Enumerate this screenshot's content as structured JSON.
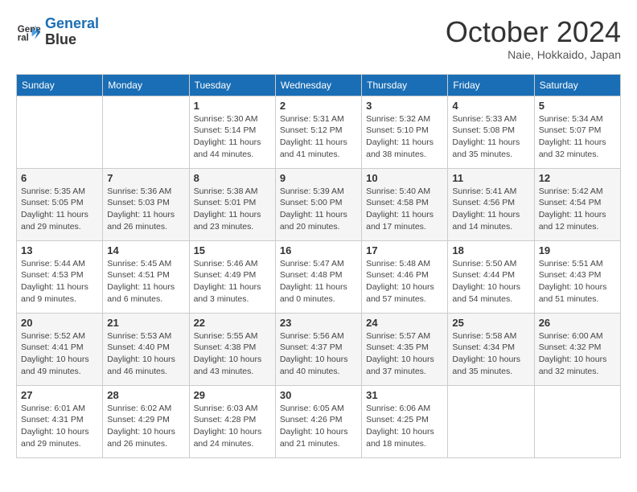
{
  "header": {
    "logo_line1": "General",
    "logo_line2": "Blue",
    "month": "October 2024",
    "location": "Naie, Hokkaido, Japan"
  },
  "weekdays": [
    "Sunday",
    "Monday",
    "Tuesday",
    "Wednesday",
    "Thursday",
    "Friday",
    "Saturday"
  ],
  "weeks": [
    [
      {
        "day": null,
        "info": null
      },
      {
        "day": null,
        "info": null
      },
      {
        "day": "1",
        "info": "Sunrise: 5:30 AM\nSunset: 5:14 PM\nDaylight: 11 hours\nand 44 minutes."
      },
      {
        "day": "2",
        "info": "Sunrise: 5:31 AM\nSunset: 5:12 PM\nDaylight: 11 hours\nand 41 minutes."
      },
      {
        "day": "3",
        "info": "Sunrise: 5:32 AM\nSunset: 5:10 PM\nDaylight: 11 hours\nand 38 minutes."
      },
      {
        "day": "4",
        "info": "Sunrise: 5:33 AM\nSunset: 5:08 PM\nDaylight: 11 hours\nand 35 minutes."
      },
      {
        "day": "5",
        "info": "Sunrise: 5:34 AM\nSunset: 5:07 PM\nDaylight: 11 hours\nand 32 minutes."
      }
    ],
    [
      {
        "day": "6",
        "info": "Sunrise: 5:35 AM\nSunset: 5:05 PM\nDaylight: 11 hours\nand 29 minutes."
      },
      {
        "day": "7",
        "info": "Sunrise: 5:36 AM\nSunset: 5:03 PM\nDaylight: 11 hours\nand 26 minutes."
      },
      {
        "day": "8",
        "info": "Sunrise: 5:38 AM\nSunset: 5:01 PM\nDaylight: 11 hours\nand 23 minutes."
      },
      {
        "day": "9",
        "info": "Sunrise: 5:39 AM\nSunset: 5:00 PM\nDaylight: 11 hours\nand 20 minutes."
      },
      {
        "day": "10",
        "info": "Sunrise: 5:40 AM\nSunset: 4:58 PM\nDaylight: 11 hours\nand 17 minutes."
      },
      {
        "day": "11",
        "info": "Sunrise: 5:41 AM\nSunset: 4:56 PM\nDaylight: 11 hours\nand 14 minutes."
      },
      {
        "day": "12",
        "info": "Sunrise: 5:42 AM\nSunset: 4:54 PM\nDaylight: 11 hours\nand 12 minutes."
      }
    ],
    [
      {
        "day": "13",
        "info": "Sunrise: 5:44 AM\nSunset: 4:53 PM\nDaylight: 11 hours\nand 9 minutes."
      },
      {
        "day": "14",
        "info": "Sunrise: 5:45 AM\nSunset: 4:51 PM\nDaylight: 11 hours\nand 6 minutes."
      },
      {
        "day": "15",
        "info": "Sunrise: 5:46 AM\nSunset: 4:49 PM\nDaylight: 11 hours\nand 3 minutes."
      },
      {
        "day": "16",
        "info": "Sunrise: 5:47 AM\nSunset: 4:48 PM\nDaylight: 11 hours\nand 0 minutes."
      },
      {
        "day": "17",
        "info": "Sunrise: 5:48 AM\nSunset: 4:46 PM\nDaylight: 10 hours\nand 57 minutes."
      },
      {
        "day": "18",
        "info": "Sunrise: 5:50 AM\nSunset: 4:44 PM\nDaylight: 10 hours\nand 54 minutes."
      },
      {
        "day": "19",
        "info": "Sunrise: 5:51 AM\nSunset: 4:43 PM\nDaylight: 10 hours\nand 51 minutes."
      }
    ],
    [
      {
        "day": "20",
        "info": "Sunrise: 5:52 AM\nSunset: 4:41 PM\nDaylight: 10 hours\nand 49 minutes."
      },
      {
        "day": "21",
        "info": "Sunrise: 5:53 AM\nSunset: 4:40 PM\nDaylight: 10 hours\nand 46 minutes."
      },
      {
        "day": "22",
        "info": "Sunrise: 5:55 AM\nSunset: 4:38 PM\nDaylight: 10 hours\nand 43 minutes."
      },
      {
        "day": "23",
        "info": "Sunrise: 5:56 AM\nSunset: 4:37 PM\nDaylight: 10 hours\nand 40 minutes."
      },
      {
        "day": "24",
        "info": "Sunrise: 5:57 AM\nSunset: 4:35 PM\nDaylight: 10 hours\nand 37 minutes."
      },
      {
        "day": "25",
        "info": "Sunrise: 5:58 AM\nSunset: 4:34 PM\nDaylight: 10 hours\nand 35 minutes."
      },
      {
        "day": "26",
        "info": "Sunrise: 6:00 AM\nSunset: 4:32 PM\nDaylight: 10 hours\nand 32 minutes."
      }
    ],
    [
      {
        "day": "27",
        "info": "Sunrise: 6:01 AM\nSunset: 4:31 PM\nDaylight: 10 hours\nand 29 minutes."
      },
      {
        "day": "28",
        "info": "Sunrise: 6:02 AM\nSunset: 4:29 PM\nDaylight: 10 hours\nand 26 minutes."
      },
      {
        "day": "29",
        "info": "Sunrise: 6:03 AM\nSunset: 4:28 PM\nDaylight: 10 hours\nand 24 minutes."
      },
      {
        "day": "30",
        "info": "Sunrise: 6:05 AM\nSunset: 4:26 PM\nDaylight: 10 hours\nand 21 minutes."
      },
      {
        "day": "31",
        "info": "Sunrise: 6:06 AM\nSunset: 4:25 PM\nDaylight: 10 hours\nand 18 minutes."
      },
      {
        "day": null,
        "info": null
      },
      {
        "day": null,
        "info": null
      }
    ]
  ]
}
